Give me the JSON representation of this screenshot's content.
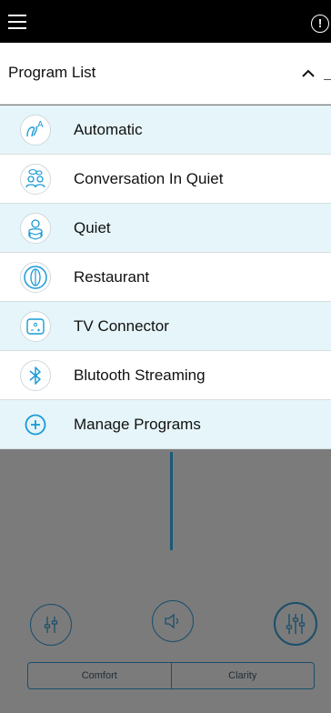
{
  "program_list": {
    "title": "Program List",
    "items": [
      {
        "label": "Automatic",
        "icon": "automatic-icon"
      },
      {
        "label": "Conversation In Quiet",
        "icon": "conversation-icon"
      },
      {
        "label": "Quiet",
        "icon": "quiet-reading-icon"
      },
      {
        "label": "Restaurant",
        "icon": "restaurant-icon"
      },
      {
        "label": "TV Connector",
        "icon": "tv-connector-icon"
      },
      {
        "label": "Blutooth Streaming",
        "icon": "bluetooth-icon"
      },
      {
        "label": "Manage Programs",
        "icon": "add-circle-icon"
      }
    ]
  },
  "controls": {
    "comfort_label": "Comfort",
    "clarity_label": "Clarity"
  },
  "colors": {
    "accent": "#1a9ad6",
    "row_highlight": "#e5f5fa",
    "overlay": "#7b7b7b",
    "topbar": "#000000"
  }
}
